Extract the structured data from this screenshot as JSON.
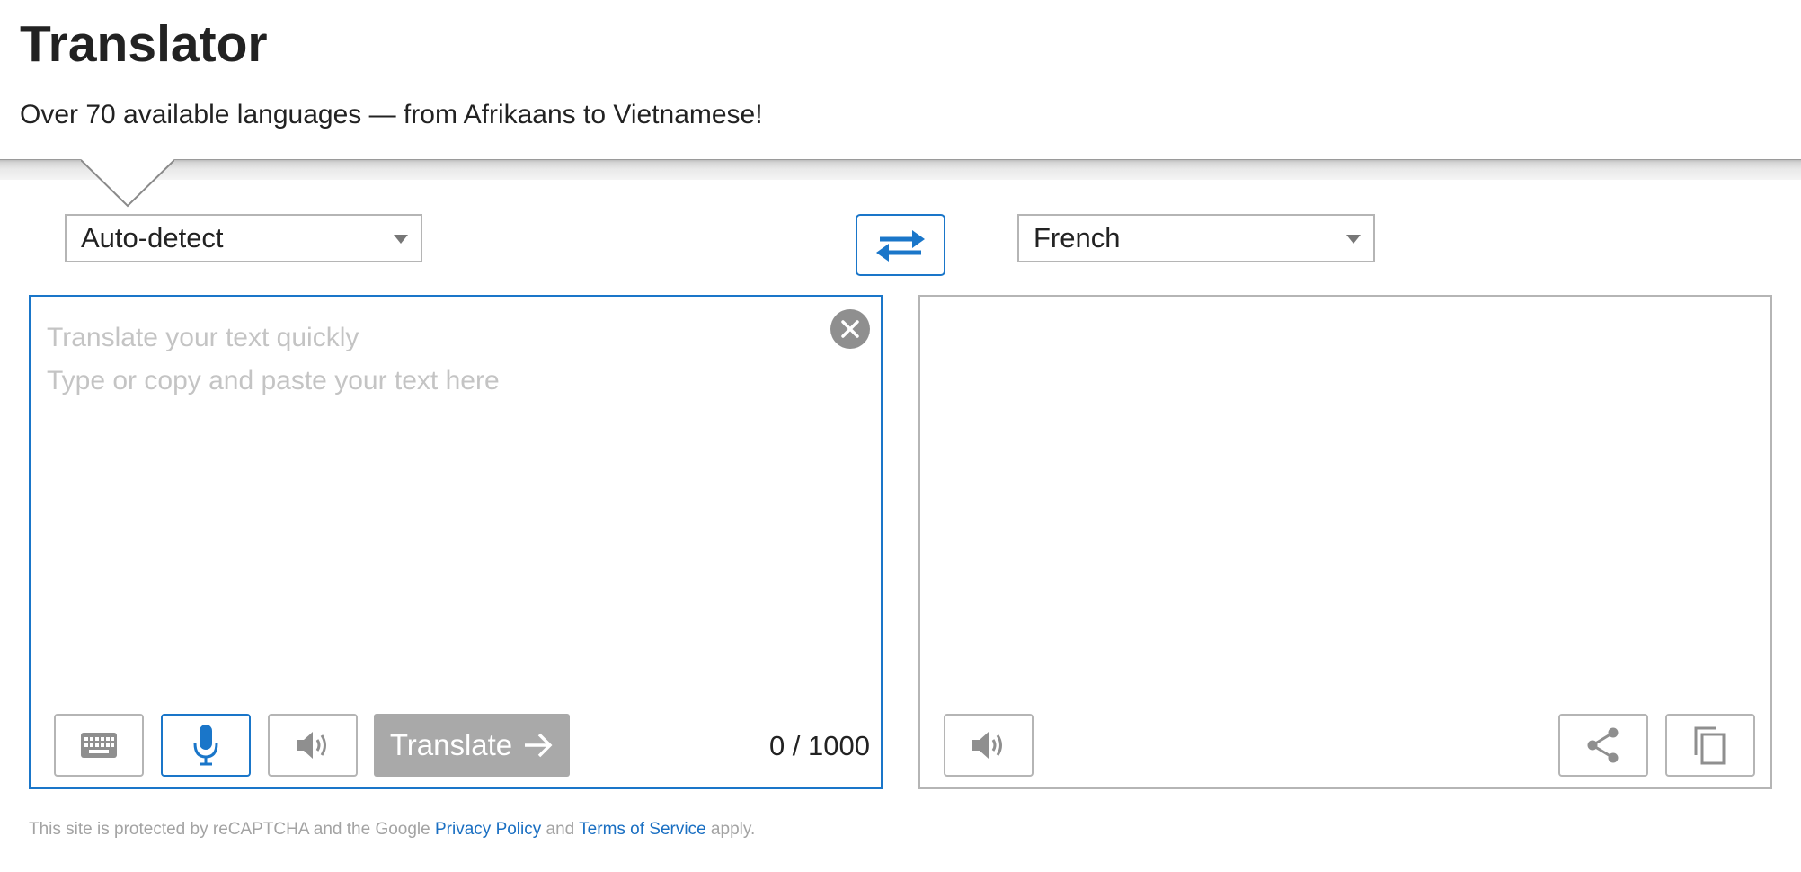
{
  "header": {
    "title": "Translator",
    "subtitle": "Over 70 available languages — from Afrikaans to Vietnamese!"
  },
  "source": {
    "language": "Auto-detect",
    "placeholder_line1": "Translate your text quickly",
    "placeholder_line2": "Type or copy and paste your text here",
    "translate_label": "Translate",
    "counter": "0 / 1000"
  },
  "target": {
    "language": "French"
  },
  "footer": {
    "prefix": "This site is protected by reCAPTCHA and the Google ",
    "privacy_link": "Privacy Policy",
    "middle": " and ",
    "terms_link": "Terms of Service",
    "suffix": " apply."
  },
  "colors": {
    "accent": "#1a76c9",
    "disabled_button": "#a9a9a9",
    "border": "#b5b5b5",
    "placeholder": "#c4c4c4"
  },
  "icons": {
    "swap": "swap-arrows-icon",
    "clear": "close-circle-icon",
    "keyboard": "keyboard-icon",
    "microphone": "microphone-icon",
    "speaker": "speaker-icon",
    "arrow": "arrow-right-icon",
    "share": "share-icon",
    "copy": "copy-icon",
    "dropdown": "chevron-down-icon"
  }
}
